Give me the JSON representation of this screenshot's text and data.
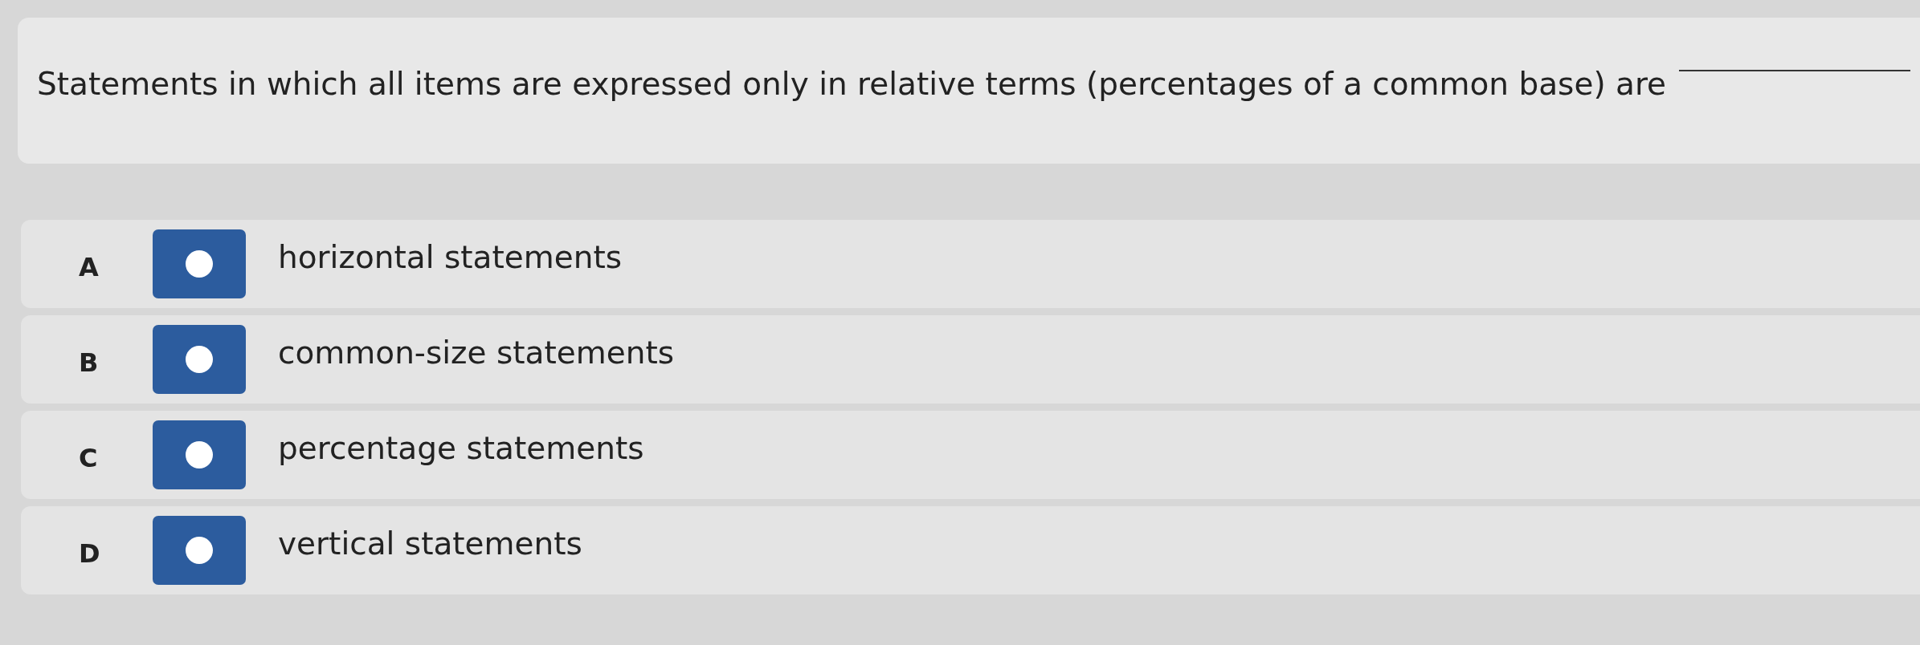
{
  "question": {
    "text": "Statements in which all items are expressed only in relative terms (percentages of a common base) are"
  },
  "options": [
    {
      "letter": "A",
      "text": "horizontal statements",
      "selected": false
    },
    {
      "letter": "B",
      "text": "common-size statements",
      "selected": false
    },
    {
      "letter": "C",
      "text": "percentage statements",
      "selected": false
    },
    {
      "letter": "D",
      "text": "vertical statements",
      "selected": false
    }
  ]
}
